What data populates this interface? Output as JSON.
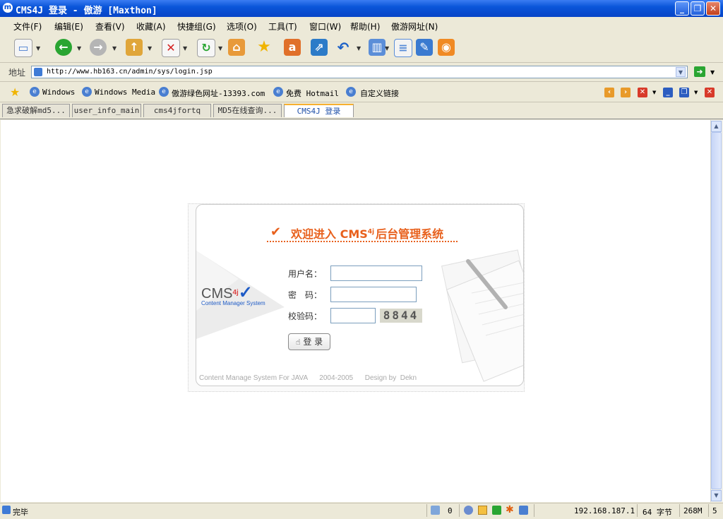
{
  "window": {
    "title": "CMS4J 登录 - 傲游 [Maxthon]"
  },
  "menu": [
    "文件(F)",
    "编辑(E)",
    "查看(V)",
    "收藏(A)",
    "快捷组(G)",
    "选项(O)",
    "工具(T)",
    "窗口(W)",
    "帮助(H)",
    "傲游网址(N)"
  ],
  "address": {
    "label": "地址",
    "url": "http://www.hb163.cn/admin/sys/login.jsp"
  },
  "favorites": [
    "Windows",
    "Windows Media",
    "傲游绿色网址-13393.com",
    "免费 Hotmail",
    "自定义链接"
  ],
  "tabs": [
    "急求破解md5...",
    "user_info_main",
    "cms4jfortq",
    "MD5在线查询...",
    "CMS4J 登录"
  ],
  "login": {
    "title": "欢迎进入 CMS",
    "title_sup": "4j",
    "title_suffix": "后台管理系统",
    "username_label": "用户名：",
    "password_label": "密　码：",
    "captcha_label": "校验码：",
    "captcha_text": "8844",
    "submit_label": "登 录",
    "logo_main": "CMS",
    "logo_sup": "4j",
    "logo_sub": "Content Manager System",
    "footer": "Content Manage System For JAVA      2004-2005      Design by  Dekn"
  },
  "status": {
    "text": "完毕",
    "count": "0",
    "ip": "192.168.187.1",
    "bytes": "64 字节",
    "memory": "268M",
    "last": "5"
  },
  "colors": {
    "titlebar": "#0a55d9",
    "accent": "#e8601c"
  }
}
